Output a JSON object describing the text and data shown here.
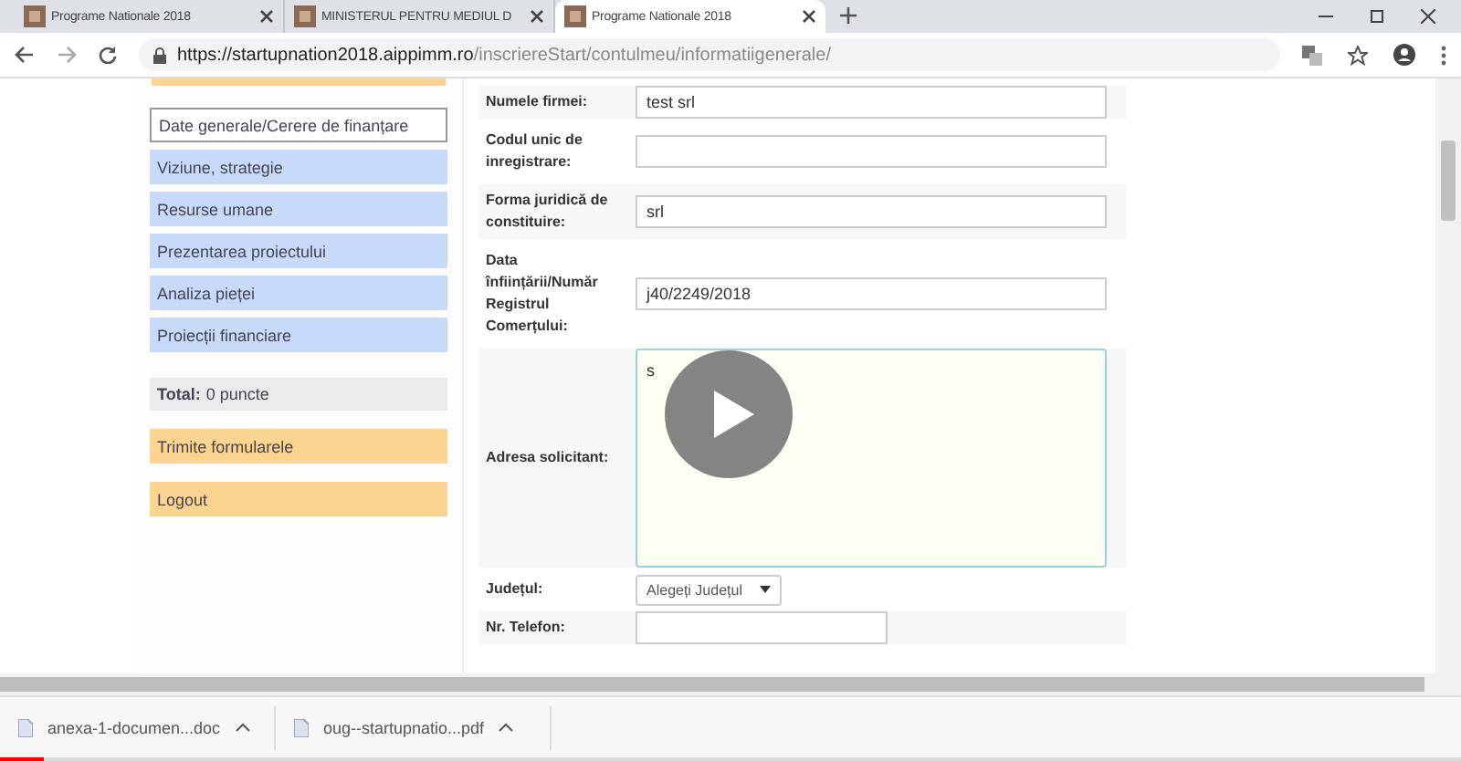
{
  "tabs": [
    {
      "title": "Programe Nationale 2018",
      "selected": false
    },
    {
      "title": "MINISTERUL PENTRU MEDIUL D",
      "selected": false
    },
    {
      "title": "Programe Nationale 2018",
      "selected": true
    }
  ],
  "address_bar": {
    "url_host": "https://startupnation2018.aippimm.ro",
    "url_path": "/inscriereStart/contulmeu/informatiigenerale/"
  },
  "sidebar": {
    "items": [
      {
        "kind": "nav",
        "label": "Date generale/Cerere de finanțare",
        "selected": true
      },
      {
        "kind": "nav",
        "label": "Viziune, strategie",
        "selected": false
      },
      {
        "kind": "nav",
        "label": "Resurse umane",
        "selected": false
      },
      {
        "kind": "nav",
        "label": "Prezentarea proiectului",
        "selected": false
      },
      {
        "kind": "nav",
        "label": "Analiza pieței",
        "selected": false
      },
      {
        "kind": "nav",
        "label": "Proiecții financiare",
        "selected": false
      },
      {
        "kind": "total",
        "label": "Total:",
        "value": "0 puncte"
      },
      {
        "kind": "action",
        "label": "Trimite formularele"
      },
      {
        "kind": "action",
        "label": "Logout"
      }
    ]
  },
  "form": {
    "rows": [
      {
        "kind": "input",
        "label": "Numele firmei:",
        "value": "test srl"
      },
      {
        "kind": "input",
        "label": "Codul unic de inregistrare:"
      },
      {
        "kind": "input",
        "label": "Forma juridică de constituire:",
        "value": "srl"
      },
      {
        "kind": "input",
        "label": "Data înființării/Număr Registrul Comerțului:",
        "value": "j40/2249/2018"
      },
      {
        "kind": "textarea",
        "label": "Adresa solicitant:",
        "value": "s"
      },
      {
        "kind": "select",
        "label": "Județul:",
        "value": "Alegeți Județul"
      },
      {
        "kind": "short_input",
        "label": "Nr. Telefon:"
      }
    ]
  },
  "downloads": [
    {
      "name": "anexa-1-documen...doc"
    },
    {
      "name": "oug--startupnatio...pdf"
    }
  ],
  "video_player": {
    "progress": {
      "level": 0.03
    }
  }
}
